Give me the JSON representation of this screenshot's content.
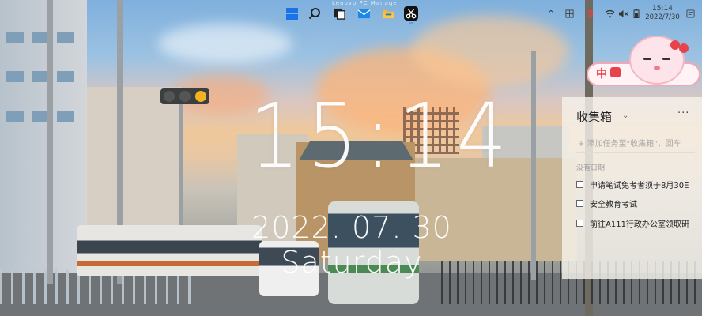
{
  "taskbar": {
    "hover_tip": "Lenovo PC Manager",
    "apps": [
      {
        "name": "windows-start",
        "color": "#1a73e8"
      },
      {
        "name": "search",
        "color": "#222222"
      },
      {
        "name": "task-view",
        "color": "#222222"
      },
      {
        "name": "mail",
        "color": "#1e88e5"
      },
      {
        "name": "file-explorer",
        "color": "#f2b632"
      },
      {
        "name": "snipping-tool",
        "color": "#111111"
      }
    ]
  },
  "tray": {
    "chevron": "^",
    "ime": "S",
    "ime_color": "#e84040",
    "clock_time": "15:14",
    "clock_date": "2022/7/30"
  },
  "wallpaper": {
    "time": "15:14",
    "date": "2022. 07. 30  Saturday"
  },
  "sticker": {
    "label": "中"
  },
  "panel": {
    "title": "收集箱",
    "more": "···",
    "add_placeholder": "+ 添加任务至\"收集箱\"，回车",
    "section_label": "没有日期",
    "tasks": [
      {
        "text": "申请笔试免考者须于8月30E"
      },
      {
        "text": "安全教育考试"
      },
      {
        "text": "前往A111行政办公室领取研"
      }
    ]
  }
}
